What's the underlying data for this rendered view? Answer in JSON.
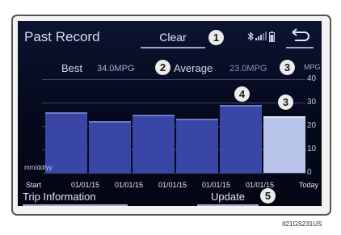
{
  "screen": {
    "title": "Past Record",
    "clear_label": "Clear",
    "best_label": "Best",
    "best_value": "34.0MPG",
    "average_label": "Average",
    "average_value": "23.0MPG",
    "unit_label": "MPG",
    "date_format": "mm/dd/yy",
    "trip_info_label": "Trip Information",
    "update_label": "Update",
    "status_icons": [
      "bluetooth-icon",
      "signal-bars-icon",
      "battery-icon"
    ],
    "back_icon": "back-arrow-icon"
  },
  "callouts": [
    "1",
    "2",
    "3",
    "4",
    "3",
    "5"
  ],
  "image_code": "II21GS231US",
  "colors": {
    "screen_bg": "#050a1e",
    "bar": "#3a46a6",
    "today_bar": "#b8c4ea",
    "callout_bg": "#ececec"
  },
  "chart_data": {
    "type": "bar",
    "categories": [
      "Start",
      "01/01/15",
      "01/01/15",
      "01/01/15",
      "01/01/15",
      "01/01/15",
      "Today"
    ],
    "values": [
      26,
      22,
      25,
      23,
      29,
      24
    ],
    "ylabel": "MPG",
    "yticks": [
      "0",
      "10",
      "20",
      "30",
      "40"
    ],
    "ylim": [
      0,
      40
    ],
    "grid": true
  }
}
